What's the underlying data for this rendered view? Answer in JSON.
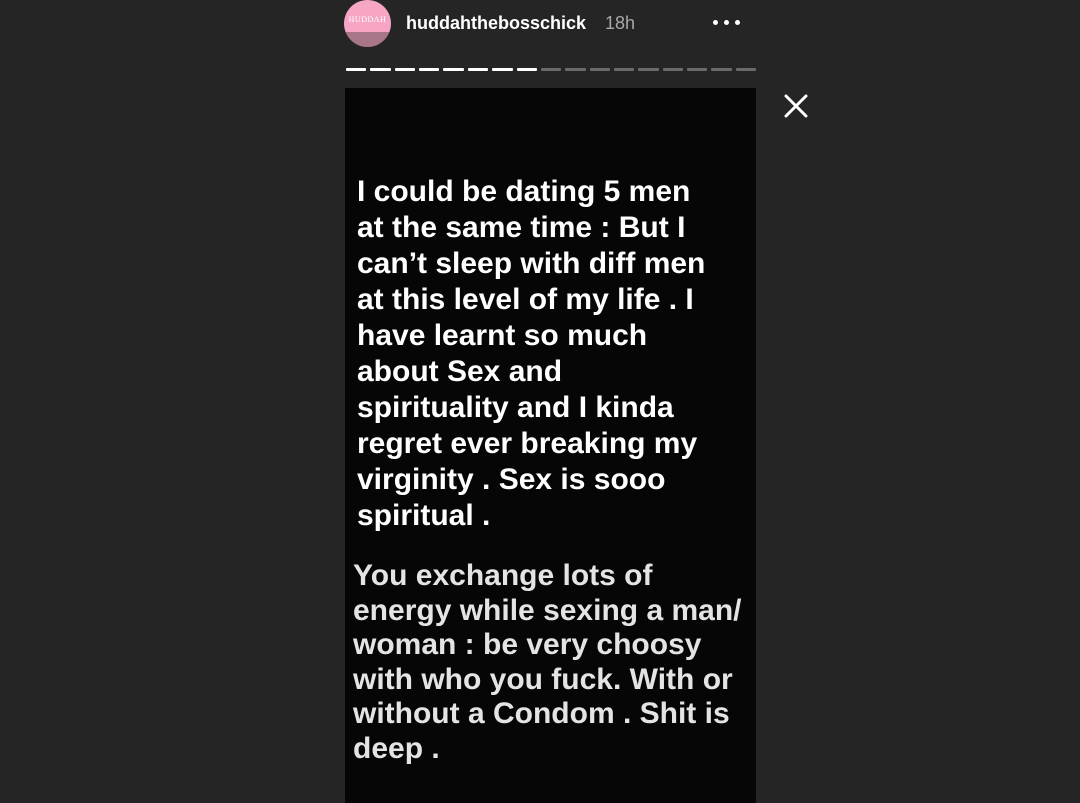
{
  "header": {
    "avatar_text": "HUDDAH",
    "username": "huddahthebosschick",
    "timestamp": "18h",
    "more_icon": "more-horizontal-icon"
  },
  "progress": {
    "total_segments": 17,
    "completed_segments": 8
  },
  "close_icon": "close-icon",
  "story": {
    "paragraph_1": "I could be dating 5 men\nat the same time : But I\ncan’t sleep with diff men\nat this level of my life . I\nhave learnt so much\nabout Sex and\nspirituality and I kinda\nregret ever breaking my\nvirginity . Sex is sooo\nspiritual .",
    "paragraph_2": "You exchange lots of\nenergy while sexing a man/\nwoman : be very choosy\nwith who you fuck. With or\nwithout a Condom . Shit is\ndeep  .",
    "background_color": "#060606",
    "text_color": "#ffffff"
  }
}
